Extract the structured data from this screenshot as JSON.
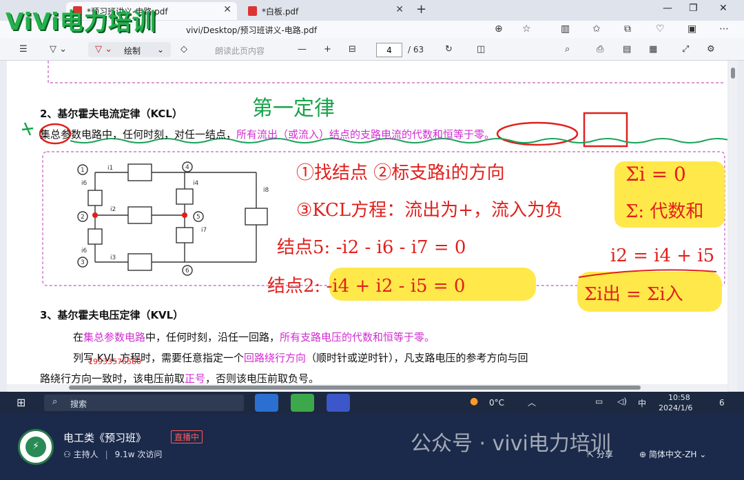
{
  "brand_watermark": "ViVi电力培训",
  "browser": {
    "tabs": [
      {
        "label": "*预习班讲义-电路.pdf",
        "active": true
      },
      {
        "label": "*白板.pdf",
        "active": false
      }
    ],
    "address": "vivi/Desktop/预习班讲义-电路.pdf"
  },
  "pdf_toolbar": {
    "draw_label": "绘制",
    "read_aloud": "朗读此页内容",
    "page_current": "4",
    "page_total": "/ 63"
  },
  "doc": {
    "kcl_heading": "2、基尔霍夫电流定律（KCL）",
    "kcl_text_a": "集总参数电路中，任何时刻，对任一结点，",
    "kcl_text_b": "所有流出（或流入）结点的支路电流的代数和恒等于零。",
    "kvl_heading": "3、基尔霍夫电压定律（KVL）",
    "kvl_p1_a": "在",
    "kvl_p1_b": "集总参数电路",
    "kvl_p1_c": "中，任何时刻，沿任一回路，",
    "kvl_p1_d": "所有支路电压的代数和恒等于零。",
    "kvl_p2_a": "列写 KVL 方程时，需要任意指定一个",
    "kvl_p2_b": "回路绕行方向",
    "kvl_p2_c": "（顺时针或逆时针），凡支路电压的参考方向与回",
    "kvl_p3_a": "路绕行方向一致时，该电压前取",
    "kvl_p3_b": "正号",
    "kvl_p3_c": "，否则该电压前取负号。",
    "phone": "19933576580",
    "circuit": {
      "nodes": [
        "1",
        "2",
        "3",
        "4",
        "5",
        "6"
      ],
      "currents": [
        "i1",
        "i2",
        "i3",
        "i4",
        "i5",
        "i6",
        "i7",
        "i8"
      ]
    },
    "handwriting": {
      "title": "第一定律",
      "step1": "①找结点 ②标支路i的方向",
      "step2": "③KCL方程：流出为+，流入为负",
      "node5": "结点5: -i2 - i6 - i7 = 0",
      "node2": "结点2: -i4 + i2 - i5 = 0",
      "sum_zero": "Σi = 0",
      "sum_def": "Σ: 代数和",
      "eq": "i2 = i4 + i5",
      "sum_in_out": "Σi出 = Σi入"
    }
  },
  "taskbar": {
    "search": "搜索",
    "weather": "0°C",
    "ime": "中",
    "time": "10:58",
    "date": "2024/1/6",
    "notif_count": "6"
  },
  "banner": {
    "title": "电工类《预习班》",
    "live": "直播中",
    "host": "主持人",
    "visits": "9.1w 次访问",
    "watermark": "公众号 · vivi电力培训",
    "share": "分享",
    "lang": "简体中文-ZH"
  }
}
